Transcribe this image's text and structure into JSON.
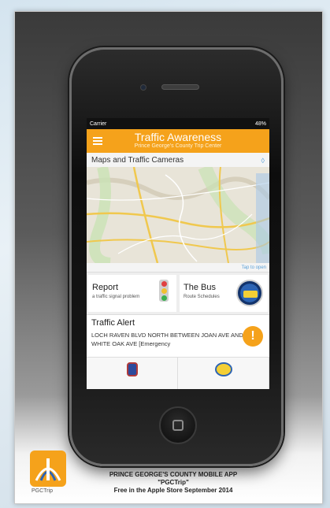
{
  "status_bar": {
    "carrier": "Carrier",
    "battery": "48%"
  },
  "header": {
    "title": "Traffic Awareness",
    "subtitle": "Prince George's County Trip Center"
  },
  "map_card": {
    "title": "Maps and Traffic Cameras",
    "tap_label": "Tap to open"
  },
  "tiles": [
    {
      "title": "Report",
      "subtitle": "a traffic signal problem"
    },
    {
      "title": "The Bus",
      "subtitle": "Route Schedules"
    }
  ],
  "alert": {
    "title": "Traffic Alert",
    "text": "LOCH RAVEN BLVD NORTH BETWEEN JOAN AVE AND WHITE OAK AVE [Emergency",
    "icon": "!"
  },
  "branding": {
    "logo_text": "PGCTrip",
    "caption_line1": "PRINCE GEORGE'S COUNTY MOBILE APP",
    "caption_line2": "\"PGCTrip\"",
    "caption_line3": "Free in the Apple Store September 2014"
  },
  "colors": {
    "accent": "#f5a21b",
    "link": "#5aa0d8"
  }
}
